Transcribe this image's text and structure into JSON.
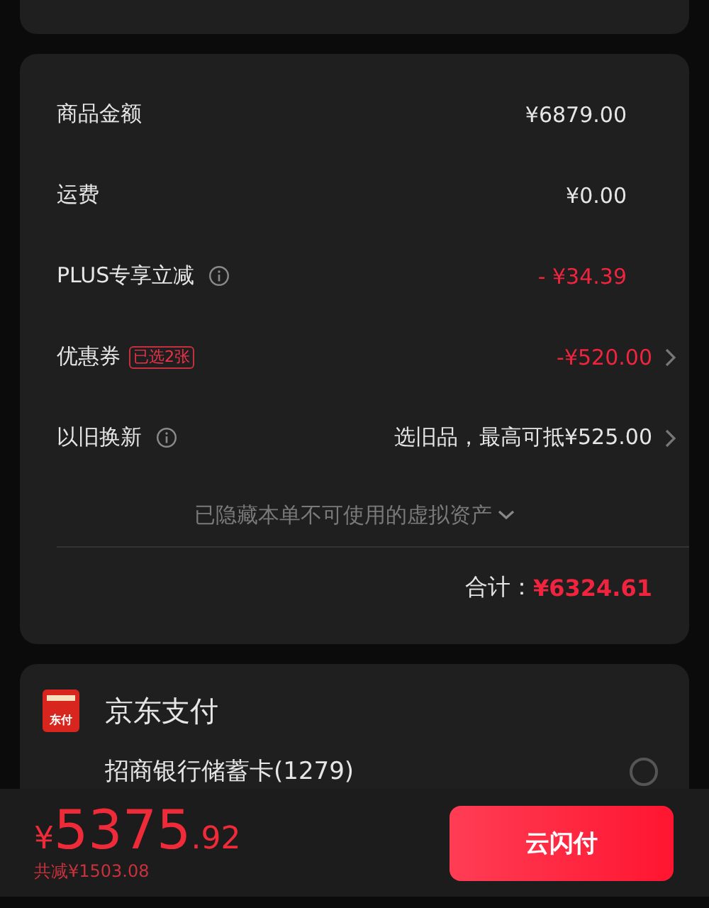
{
  "summary": {
    "rows": [
      {
        "label": "商品金额",
        "info": false,
        "tag": null,
        "value": "¥6879.00",
        "highlight": false,
        "arrow": false
      },
      {
        "label": "运费",
        "info": false,
        "tag": null,
        "value": "¥0.00",
        "highlight": false,
        "arrow": false
      },
      {
        "label": "PLUS专享立减",
        "info": true,
        "tag": null,
        "value": "- ¥34.39",
        "highlight": true,
        "arrow": false
      },
      {
        "label": "优惠券",
        "info": false,
        "tag": "已选2张",
        "value": "-¥520.00",
        "highlight": true,
        "arrow": true
      },
      {
        "label": "以旧换新",
        "info": true,
        "tag": null,
        "value": "选旧品，最高可抵¥525.00",
        "highlight": false,
        "arrow": true
      }
    ],
    "hidden_note": "已隐藏本单不可使用的虚拟资产",
    "hidden_expanded": false,
    "total_label": "合计：",
    "total_value": "¥6324.61"
  },
  "payment": {
    "logo_text": "东付",
    "title": "京东支付",
    "options": [
      {
        "label": "招商银行储蓄卡(1279)",
        "selected": false
      }
    ]
  },
  "footer": {
    "price": {
      "currency": "¥",
      "integer": "5375",
      "decimal": ".92"
    },
    "saved": "共减¥1503.08",
    "pay_button": "云闪付"
  }
}
